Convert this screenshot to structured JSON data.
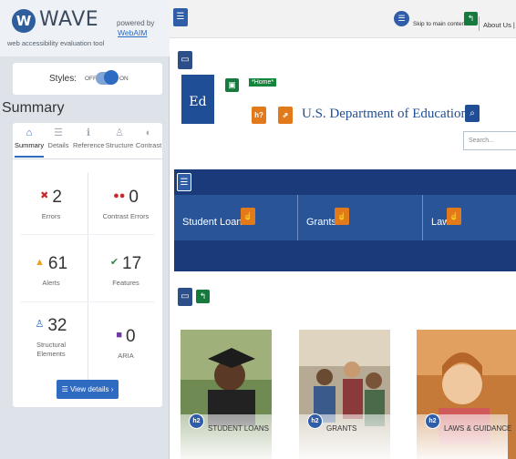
{
  "wave": {
    "logo_letter": "W",
    "title": "WAVE",
    "subtitle": "web accessibility evaluation tool",
    "powered_by": "powered by",
    "webaim_link": "WebAIM",
    "styles_label": "Styles:",
    "styles_off": "OFF",
    "styles_on": "ON",
    "summary_heading": "Summary",
    "tabs": [
      {
        "label": "Summary",
        "icon": "home-icon",
        "glyph": "⌂"
      },
      {
        "label": "Details",
        "icon": "list-icon",
        "glyph": "☰"
      },
      {
        "label": "Reference",
        "icon": "info-icon",
        "glyph": "ℹ"
      },
      {
        "label": "Structure",
        "icon": "structure-icon",
        "glyph": "♙"
      },
      {
        "label": "Contrast",
        "icon": "contrast-icon",
        "glyph": "◐"
      }
    ],
    "stats": {
      "errors": {
        "count": "2",
        "label": "Errors",
        "color": "#cc2a2a"
      },
      "contrast_errors": {
        "count": "0",
        "label": "Contrast Errors",
        "color": "#cc2a2a"
      },
      "alerts": {
        "count": "61",
        "label": "Alerts",
        "color": "#e9a220"
      },
      "features": {
        "count": "17",
        "label": "Features",
        "color": "#2f8a4a"
      },
      "structural": {
        "count": "32",
        "label": "Structural Elements",
        "color": "#2f6bc0"
      },
      "aria": {
        "count": "0",
        "label": "ARIA",
        "color": "#6b3ba0"
      }
    },
    "view_details_button": "View details ›"
  },
  "page": {
    "skip_link": "Skip to main content",
    "about_link": "About Us | C",
    "home_badge": "*Home*",
    "department_title": "U.S. Department of Education",
    "search_placeholder": "Search...",
    "nav": [
      "Student Loans",
      "Grants",
      "Laws"
    ],
    "cards": [
      {
        "label": "STUDENT LOANS",
        "heading_badge": "h2"
      },
      {
        "label": "GRANTS",
        "heading_badge": "h2"
      },
      {
        "label": "LAWS & GUIDANCE",
        "heading_badge": "h2"
      }
    ]
  },
  "colors": {
    "accent": "#2f6bc0",
    "nav_band": "#1a3a7a",
    "nav_strip": "#2a5498"
  }
}
